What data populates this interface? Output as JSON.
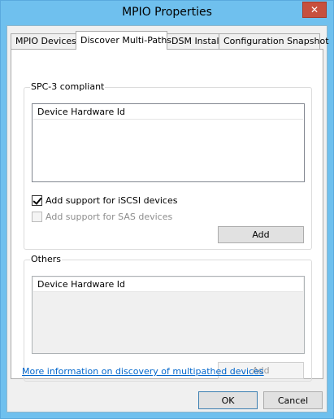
{
  "window": {
    "title": "MPIO Properties",
    "close_glyph": "✕"
  },
  "tabs": [
    {
      "label": "MPIO Devices"
    },
    {
      "label": "Discover Multi-Paths"
    },
    {
      "label": "DSM Install"
    },
    {
      "label": "Configuration Snapshot"
    }
  ],
  "spc3": {
    "group_label": "SPC-3 compliant",
    "list_header": "Device Hardware Id",
    "iscsi_label": "Add support for iSCSI devices",
    "iscsi_checked": true,
    "sas_label": "Add support for SAS devices",
    "sas_checked": false,
    "add_label": "Add"
  },
  "others": {
    "group_label": "Others",
    "list_header": "Device Hardware Id",
    "add_label": "Add"
  },
  "link_text": "More information on discovery of multipathed devices",
  "footer": {
    "ok_label": "OK",
    "cancel_label": "Cancel"
  }
}
